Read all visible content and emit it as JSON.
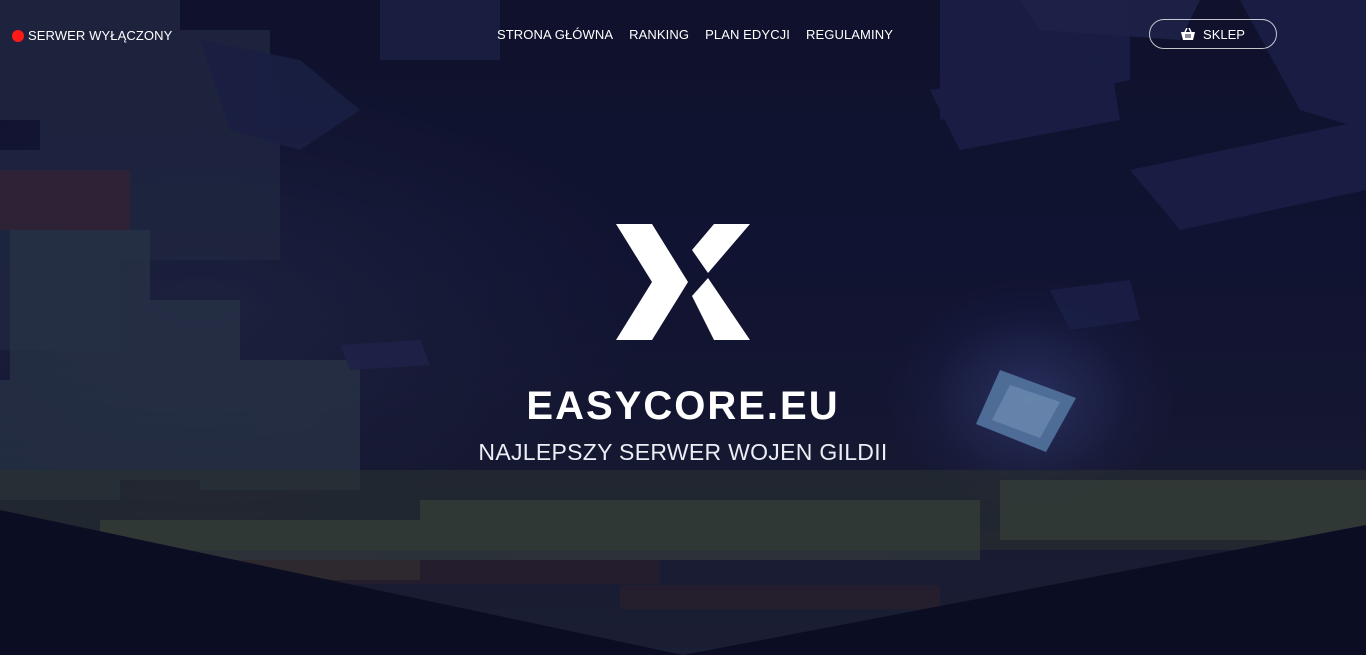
{
  "server_status": {
    "label": "SERWER WYŁĄCZONY",
    "indicator_color": "#ff1a1a"
  },
  "nav": {
    "items": [
      {
        "label": "STRONA GŁÓWNA"
      },
      {
        "label": "RANKING"
      },
      {
        "label": "PLAN EDYCJI"
      },
      {
        "label": "REGULAMINY"
      }
    ]
  },
  "shop": {
    "label": "SKLEP",
    "icon": "basket-icon"
  },
  "hero": {
    "logo_icon": "x-logo-icon",
    "title": "EASYCORE.EU",
    "subtitle": "NAJLEPSZY SERWER WOJEN GILDII"
  },
  "colors": {
    "background": "#0d0e24",
    "text": "#ffffff"
  }
}
